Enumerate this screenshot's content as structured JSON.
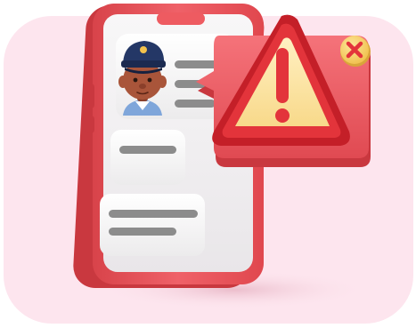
{
  "illustration": {
    "colors": {
      "background_card": "#fde5ee",
      "phone_body": "#ee5b61",
      "phone_body_dark": "#c9383f",
      "phone_screen": "#f3f1f3",
      "content_line": "#8c8c8c",
      "warning_yellow": "#fbe3a0",
      "warning_red": "#e3343b",
      "close_badge_yellow": "#f6cf63",
      "avatar_skin": "#a9553a",
      "avatar_cap": "#243766"
    },
    "icons": [
      "warning-triangle-icon",
      "close-icon",
      "avatar-police-officer"
    ]
  }
}
